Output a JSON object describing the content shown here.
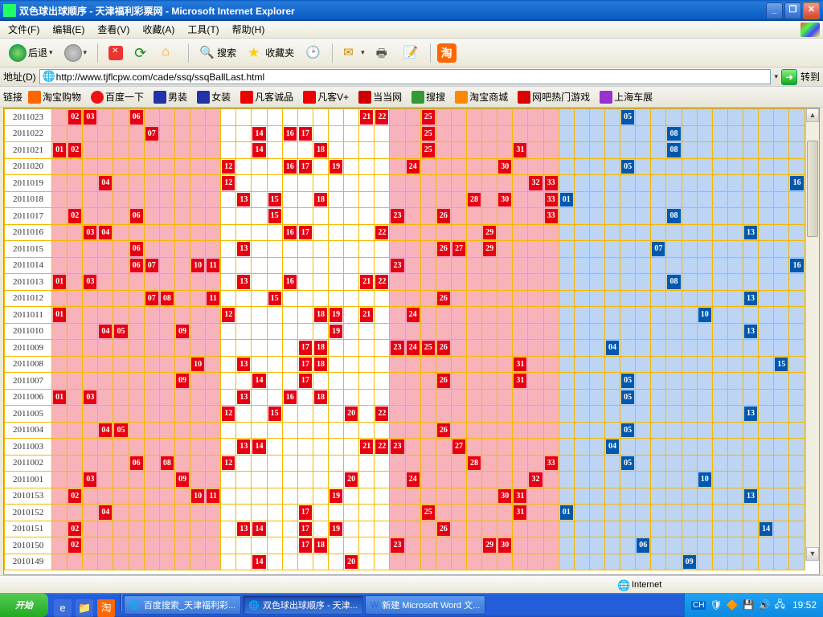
{
  "window": {
    "title": "双色球出球顺序 - 天津福利彩票网 - Microsoft Internet Explorer"
  },
  "menu": [
    "文件(F)",
    "编辑(E)",
    "查看(V)",
    "收藏(A)",
    "工具(T)",
    "帮助(H)"
  ],
  "toolbar": {
    "back": "后退",
    "search": "搜索",
    "favorites": "收藏夹"
  },
  "address": {
    "label": "地址(D)",
    "url": "http://www.tjflcpw.com/cade/ssq/ssqBallLast.html",
    "go": "转到"
  },
  "links": {
    "label": "链接",
    "items": [
      "淘宝购物",
      "百度一下",
      "男装",
      "女装",
      "凡客诚品",
      "凡客V+",
      "当当网",
      "搜搜",
      "淘宝商城",
      "网吧热门游戏",
      "上海车展"
    ]
  },
  "status": {
    "zone": "Internet"
  },
  "taskbar": {
    "start": "开始",
    "tasks": [
      "百度搜索_天津福利彩...",
      "双色球出球顺序 - 天津...",
      "新建 Microsoft Word 文..."
    ],
    "clock": "19:52"
  },
  "chart_data": {
    "type": "table",
    "title": "双色球出球顺序",
    "red_range": [
      1,
      33
    ],
    "blue_range": [
      1,
      16
    ],
    "zones": {
      "A": [
        1,
        11
      ],
      "B": [
        12,
        22
      ],
      "C": [
        23,
        33
      ],
      "D_blue": [
        1,
        16
      ]
    },
    "rows": [
      {
        "period": "2011023",
        "red": [
          2,
          3,
          6,
          21,
          22,
          25
        ],
        "blue": [
          5
        ]
      },
      {
        "period": "2011022",
        "red": [
          7,
          14,
          16,
          17,
          25
        ],
        "blue": [
          8
        ]
      },
      {
        "period": "2011021",
        "red": [
          1,
          2,
          14,
          18,
          25,
          31
        ],
        "blue": [
          8
        ]
      },
      {
        "period": "2011020",
        "red": [
          12,
          16,
          17,
          19,
          24,
          30
        ],
        "blue": [
          5
        ]
      },
      {
        "period": "2011019",
        "red": [
          4,
          12,
          32,
          33
        ],
        "blue": [
          16
        ]
      },
      {
        "period": "2011018",
        "red": [
          13,
          15,
          18,
          28,
          30,
          33
        ],
        "blue": [
          1
        ]
      },
      {
        "period": "2011017",
        "red": [
          2,
          6,
          15,
          23,
          26,
          33
        ],
        "blue": [
          8
        ]
      },
      {
        "period": "2011016",
        "red": [
          3,
          4,
          16,
          17,
          22,
          29
        ],
        "blue": [
          13
        ]
      },
      {
        "period": "2011015",
        "red": [
          6,
          13,
          26,
          27,
          29
        ],
        "blue": [
          7
        ]
      },
      {
        "period": "2011014",
        "red": [
          6,
          7,
          10,
          11,
          23
        ],
        "blue": [
          16
        ]
      },
      {
        "period": "2011013",
        "red": [
          1,
          3,
          13,
          16,
          21,
          22
        ],
        "blue": [
          8
        ]
      },
      {
        "period": "2011012",
        "red": [
          7,
          8,
          11,
          15,
          26
        ],
        "blue": [
          13
        ]
      },
      {
        "period": "2011011",
        "red": [
          1,
          12,
          18,
          19,
          21,
          24
        ],
        "blue": [
          10
        ]
      },
      {
        "period": "2011010",
        "red": [
          4,
          5,
          9,
          19
        ],
        "blue": [
          13
        ]
      },
      {
        "period": "2011009",
        "red": [
          17,
          18,
          23,
          24,
          25,
          26
        ],
        "blue": [
          4
        ]
      },
      {
        "period": "2011008",
        "red": [
          10,
          13,
          17,
          18,
          31
        ],
        "blue": [
          15
        ]
      },
      {
        "period": "2011007",
        "red": [
          9,
          14,
          17,
          26,
          31
        ],
        "blue": [
          5
        ]
      },
      {
        "period": "2011006",
        "red": [
          1,
          3,
          13,
          16,
          18
        ],
        "blue": [
          5
        ]
      },
      {
        "period": "2011005",
        "red": [
          12,
          15,
          20,
          22
        ],
        "blue": [
          13
        ]
      },
      {
        "period": "2011004",
        "red": [
          4,
          5,
          26
        ],
        "blue": [
          5
        ]
      },
      {
        "period": "2011003",
        "red": [
          13,
          14,
          21,
          22,
          23,
          27
        ],
        "blue": [
          4
        ]
      },
      {
        "period": "2011002",
        "red": [
          6,
          8,
          12,
          28,
          33
        ],
        "blue": [
          5
        ]
      },
      {
        "period": "2011001",
        "red": [
          3,
          9,
          20,
          24,
          32
        ],
        "blue": [
          10
        ]
      },
      {
        "period": "2010153",
        "red": [
          2,
          10,
          11,
          19,
          30,
          31
        ],
        "blue": [
          13
        ]
      },
      {
        "period": "2010152",
        "red": [
          4,
          17,
          25,
          31
        ],
        "blue": [
          1
        ]
      },
      {
        "period": "2010151",
        "red": [
          2,
          13,
          14,
          17,
          19,
          26
        ],
        "blue": [
          14
        ]
      },
      {
        "period": "2010150",
        "red": [
          2,
          17,
          18,
          23,
          29,
          30
        ],
        "blue": [
          6
        ]
      },
      {
        "period": "2010149",
        "red": [
          14,
          20
        ],
        "blue": [
          9
        ]
      }
    ]
  }
}
